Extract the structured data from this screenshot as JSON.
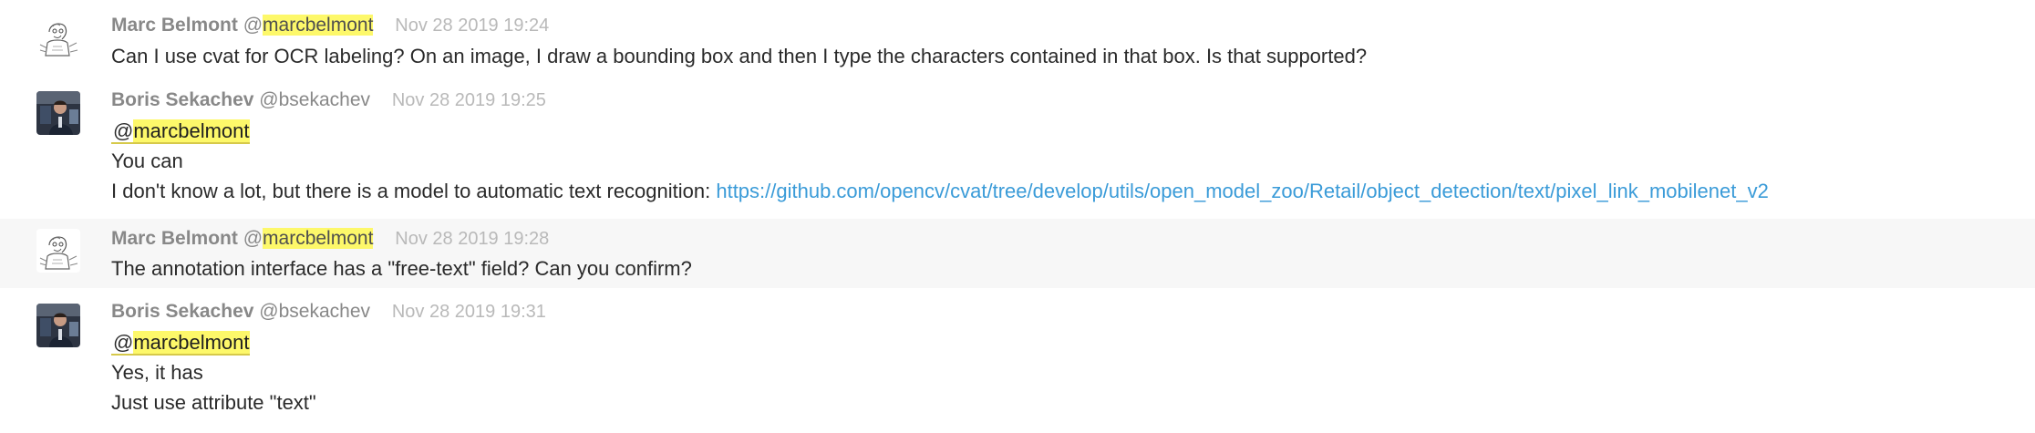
{
  "messages": [
    {
      "author": "Marc Belmont",
      "handle_at": "@",
      "handle": "marcbelmont",
      "timestamp": "Nov 28 2019 19:24",
      "lines": [
        "Can I use cvat for OCR labeling? On an image, I draw a bounding box and then I type the characters contained in that box. Is that supported?"
      ]
    },
    {
      "author": "Boris Sekachev",
      "handle": "@bsekachev",
      "timestamp": "Nov 28 2019 19:25",
      "mention_at": "@",
      "mention": "marcbelmont",
      "lines": [
        "You can",
        "I don't know a lot, but there is a model to automatic text recognition: "
      ],
      "link": "https://github.com/opencv/cvat/tree/develop/utils/open_model_zoo/Retail/object_detection/text/pixel_link_mobilenet_v2"
    },
    {
      "author": "Marc Belmont",
      "handle_at": "@",
      "handle": "marcbelmont",
      "timestamp": "Nov 28 2019 19:28",
      "lines": [
        "The annotation interface has a \"free-text\" field? Can you confirm?"
      ]
    },
    {
      "author": "Boris Sekachev",
      "handle": "@bsekachev",
      "timestamp": "Nov 28 2019 19:31",
      "mention_at": "@",
      "mention": "marcbelmont",
      "lines": [
        "Yes, it has",
        "Just use attribute \"text\""
      ]
    }
  ],
  "icons": {
    "marc_avatar": "sketch-avatar-icon",
    "boris_avatar": "photo-avatar-icon"
  }
}
